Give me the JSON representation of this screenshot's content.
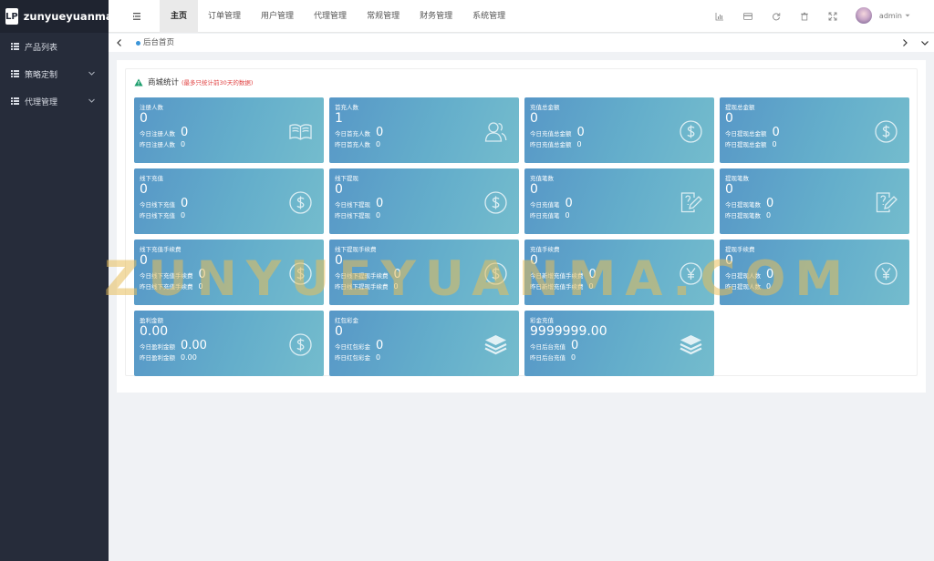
{
  "app": {
    "logo_glyph": "LP",
    "name": "zunyueyuanma"
  },
  "sidebar": {
    "items": [
      {
        "label": "产品列表",
        "has_children": false
      },
      {
        "label": "策略定制",
        "has_children": true
      },
      {
        "label": "代理管理",
        "has_children": true
      }
    ]
  },
  "header": {
    "tabs": [
      "主页",
      "订单管理",
      "用户管理",
      "代理管理",
      "常规管理",
      "财务管理",
      "系统管理"
    ],
    "active_tab": 0,
    "icons": [
      "chart-icon",
      "card-icon",
      "refresh-icon",
      "trash-icon",
      "fullscreen-icon"
    ],
    "user": {
      "name": "admin"
    }
  },
  "page_tabs": {
    "current": "后台首页"
  },
  "panel": {
    "title": "商城统计",
    "note": "(最多只统计前30天的数据)"
  },
  "cards": [
    {
      "title": "注册人数",
      "value": "0",
      "today_label": "今日注册人数",
      "today_value": "0",
      "yesterday_label": "昨日注册人数",
      "yesterday_value": "0",
      "icon": "book-icon"
    },
    {
      "title": "首充人数",
      "value": "1",
      "today_label": "今日首充人数",
      "today_value": "0",
      "yesterday_label": "昨日首充人数",
      "yesterday_value": "0",
      "icon": "users-icon"
    },
    {
      "title": "充值总金额",
      "value": "0",
      "today_label": "今日充值总金额",
      "today_value": "0",
      "yesterday_label": "昨日充值总金额",
      "yesterday_value": "0",
      "icon": "dollar-icon"
    },
    {
      "title": "提现总金额",
      "value": "0",
      "today_label": "今日提现总金额",
      "today_value": "0",
      "yesterday_label": "昨日提现总金额",
      "yesterday_value": "0",
      "icon": "dollar-icon"
    },
    {
      "title": "线下充值",
      "value": "0",
      "today_label": "今日线下充值",
      "today_value": "0",
      "yesterday_label": "昨日线下充值",
      "yesterday_value": "0",
      "icon": "dollar-icon"
    },
    {
      "title": "线下提现",
      "value": "0",
      "today_label": "今日线下提现",
      "today_value": "0",
      "yesterday_label": "昨日线下提现",
      "yesterday_value": "0",
      "icon": "dollar-icon"
    },
    {
      "title": "充值笔数",
      "value": "0",
      "today_label": "今日充值笔",
      "today_value": "0",
      "yesterday_label": "昨日充值笔",
      "yesterday_value": "0",
      "icon": "edit-doc-icon"
    },
    {
      "title": "提现笔数",
      "value": "0",
      "today_label": "今日提现笔数",
      "today_value": "0",
      "yesterday_label": "昨日提现笔数",
      "yesterday_value": "0",
      "icon": "edit-doc-icon"
    },
    {
      "title": "线下充值手续费",
      "value": "0",
      "today_label": "今日线下充值手续费",
      "today_value": "0",
      "yesterday_label": "昨日线下充值手续费",
      "yesterday_value": "0",
      "icon": "dollar-icon"
    },
    {
      "title": "线下提现手续费",
      "value": "0",
      "today_label": "今日线下提现手续费",
      "today_value": "0",
      "yesterday_label": "昨日线下提现手续费",
      "yesterday_value": "0",
      "icon": "dollar-icon"
    },
    {
      "title": "充值手续费",
      "value": "0",
      "today_label": "今日新增充值手续费",
      "today_value": "0",
      "yesterday_label": "昨日新增充值手续费",
      "yesterday_value": "0",
      "icon": "yen-icon"
    },
    {
      "title": "提现手续费",
      "value": "0",
      "today_label": "今日提现人数",
      "today_value": "0",
      "yesterday_label": "昨日提现人数",
      "yesterday_value": "0",
      "icon": "yen-icon"
    },
    {
      "title": "盈利金额",
      "value": "0.00",
      "today_label": "今日盈利金额",
      "today_value": "0.00",
      "yesterday_label": "昨日盈利金额",
      "yesterday_value": "0.00",
      "icon": "dollar-icon"
    },
    {
      "title": "红包彩金",
      "value": "0",
      "today_label": "今日红包彩金",
      "today_value": "0",
      "yesterday_label": "昨日红包彩金",
      "yesterday_value": "0",
      "icon": "stack-icon"
    },
    {
      "title": "彩金充值",
      "value": "9999999.00",
      "today_label": "今日后台充值",
      "today_value": "0",
      "yesterday_label": "昨日后台充值",
      "yesterday_value": "0",
      "icon": "stack-icon"
    }
  ],
  "watermark": "ZUNYUEYUANMA.COM"
}
